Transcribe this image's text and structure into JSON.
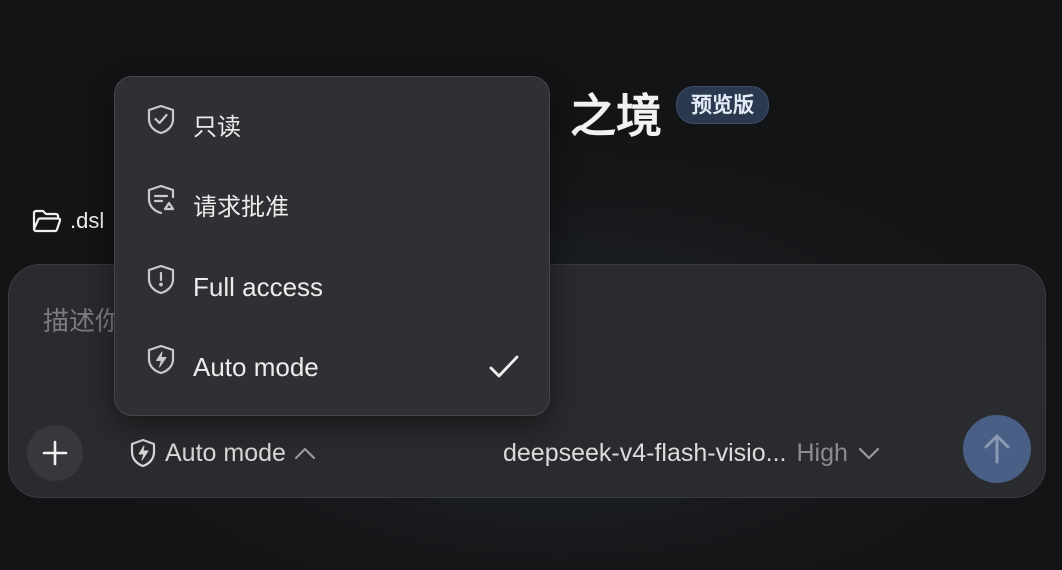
{
  "header": {
    "title": "之境",
    "badge": "预览版"
  },
  "workspace": {
    "icon": "folder-icon",
    "label": ".dsl"
  },
  "composer": {
    "placeholder": "描述你",
    "mode_label": "Auto mode",
    "model_name": "deepseek-v4-flash-visio...",
    "effort_label": "High"
  },
  "permission_menu": {
    "items": [
      {
        "label": "只读",
        "icon": "shield-check-icon",
        "selected": false
      },
      {
        "label": "请求批准",
        "icon": "shield-list-icon",
        "selected": false
      },
      {
        "label": "Full access",
        "icon": "shield-alert-icon",
        "selected": false
      },
      {
        "label": "Auto mode",
        "icon": "shield-bolt-icon",
        "selected": true
      }
    ]
  },
  "colors": {
    "accent": "#4a5f86",
    "badge_bg": "#2a3950"
  }
}
